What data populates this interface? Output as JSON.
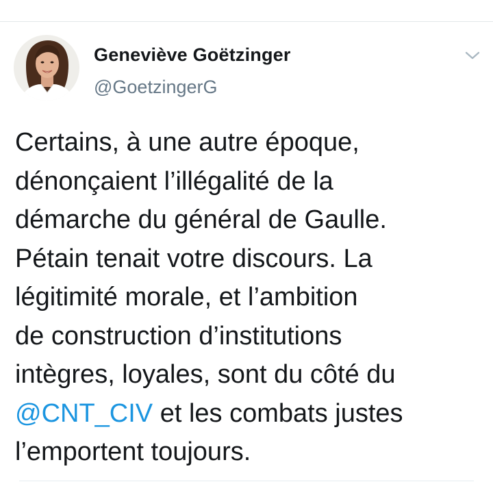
{
  "tweet": {
    "author": {
      "name": "Geneviève Goëtzinger",
      "handle": "@GoetzingerG"
    },
    "text_lines": [
      "Certains, à une autre époque,",
      "dénonçaient l’illégalité de la",
      "démarche du général de Gaulle.",
      "Pétain tenait votre discours. La",
      "légitimité morale, et l’ambition",
      "de construction d’institutions",
      "intègres, loyales, sont du côté du"
    ],
    "mention": "@CNT_CIV",
    "line8_rest": " et les combats justes",
    "line9": "l’emportent toujours.",
    "menu_icon": "chevron-down-icon"
  },
  "colors": {
    "link": "#1b95e0",
    "text": "#14171a",
    "secondary": "#657786",
    "divider": "#e3e7ea"
  }
}
